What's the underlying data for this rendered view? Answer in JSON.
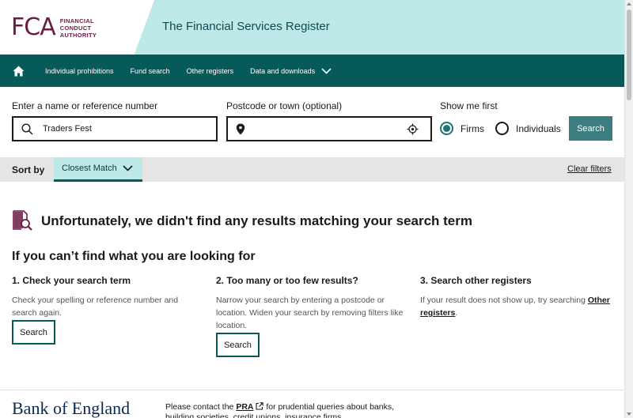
{
  "header": {
    "logo_mark": "FCA",
    "logo_lines": [
      "FINANCIAL",
      "CONDUCT",
      "AUTHORITY"
    ],
    "site_title": "The Financial Services Register"
  },
  "nav": {
    "home_icon": "home-icon",
    "items": [
      "Individual prohibitions",
      "Fund search",
      "Other registers",
      "Data and downloads"
    ]
  },
  "search": {
    "name_label": "Enter a name or reference number",
    "name_value": "Traders Fest",
    "postcode_label": "Postcode or town (optional)",
    "postcode_value": "",
    "show_me_first_label": "Show me first",
    "options": [
      "Firms",
      "Individuals"
    ],
    "selected_option": "Firms",
    "button": "Search"
  },
  "sort": {
    "label": "Sort by",
    "value": "Closest Match",
    "clear_filters": "Clear filters"
  },
  "results": {
    "no_results_title": "Unfortunately, we didn't find any results matching your search term",
    "help_title": "If you can’t find what you are looking for",
    "columns": [
      {
        "title": "1. Check your search term",
        "text": "Check your spelling or reference number and search again.",
        "button": "Search"
      },
      {
        "title": "2. Too many or too few results?",
        "text": "Narrow your search by entering a postcode or location. Widen your search by removing filters like location.",
        "button": "Search"
      },
      {
        "title": "3. Search other registers",
        "text_before": "If your result does not show up, try searching ",
        "link": "Other registers",
        "text_after": "."
      }
    ]
  },
  "footer": {
    "bank_name": "Bank of England",
    "pra_before": "Please contact the ",
    "pra_link": "PRA",
    "pra_after": " for prudential queries about banks, building societies, credit unions, insurance firms"
  },
  "colors": {
    "nav_bg": "#065a5a",
    "header_bg": "#bdeae8",
    "brand": "#6a1c45",
    "search_button": "#3c7e80"
  }
}
